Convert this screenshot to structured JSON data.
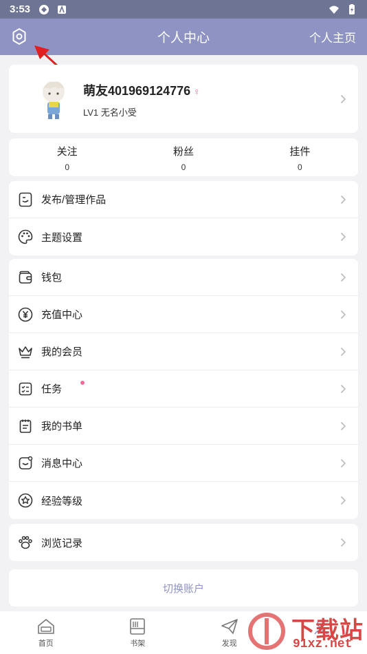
{
  "status_bar": {
    "time": "3:53"
  },
  "header": {
    "title": "个人中心",
    "homepage": "个人主页"
  },
  "profile": {
    "name": "萌友401969124776",
    "gender_symbol": "♀",
    "level": "LV1 无名小受"
  },
  "stats": [
    {
      "label": "关注",
      "value": "0"
    },
    {
      "label": "粉丝",
      "value": "0"
    },
    {
      "label": "挂件",
      "value": "0"
    }
  ],
  "menu_group1": [
    {
      "label": "发布/管理作品",
      "icon": "document-icon"
    },
    {
      "label": "主题设置",
      "icon": "palette-icon"
    }
  ],
  "menu_group2": [
    {
      "label": "钱包",
      "icon": "wallet-icon"
    },
    {
      "label": "充值中心",
      "icon": "yen-icon"
    },
    {
      "label": "我的会员",
      "icon": "crown-icon"
    },
    {
      "label": "任务",
      "icon": "checklist-icon",
      "badge": true
    },
    {
      "label": "我的书单",
      "icon": "booklist-icon"
    },
    {
      "label": "消息中心",
      "icon": "message-icon"
    },
    {
      "label": "经验等级",
      "icon": "star-badge-icon"
    }
  ],
  "menu_group3": [
    {
      "label": "浏览记录",
      "icon": "paw-icon"
    }
  ],
  "switch_account": "切换账户",
  "tabs": [
    {
      "label": "首页",
      "icon": "home-icon"
    },
    {
      "label": "书架",
      "icon": "bookshelf-icon"
    },
    {
      "label": "发现",
      "icon": "paper-plane-icon"
    },
    {
      "label": "",
      "icon": "profile-icon"
    }
  ],
  "watermark": {
    "text": "下载站",
    "url_text": "91xz.net"
  },
  "colors": {
    "header": "#8e93c4",
    "status_bar": "#6d7494",
    "accent_pink": "#f06a9a",
    "annotation_arrow": "#e02020"
  }
}
